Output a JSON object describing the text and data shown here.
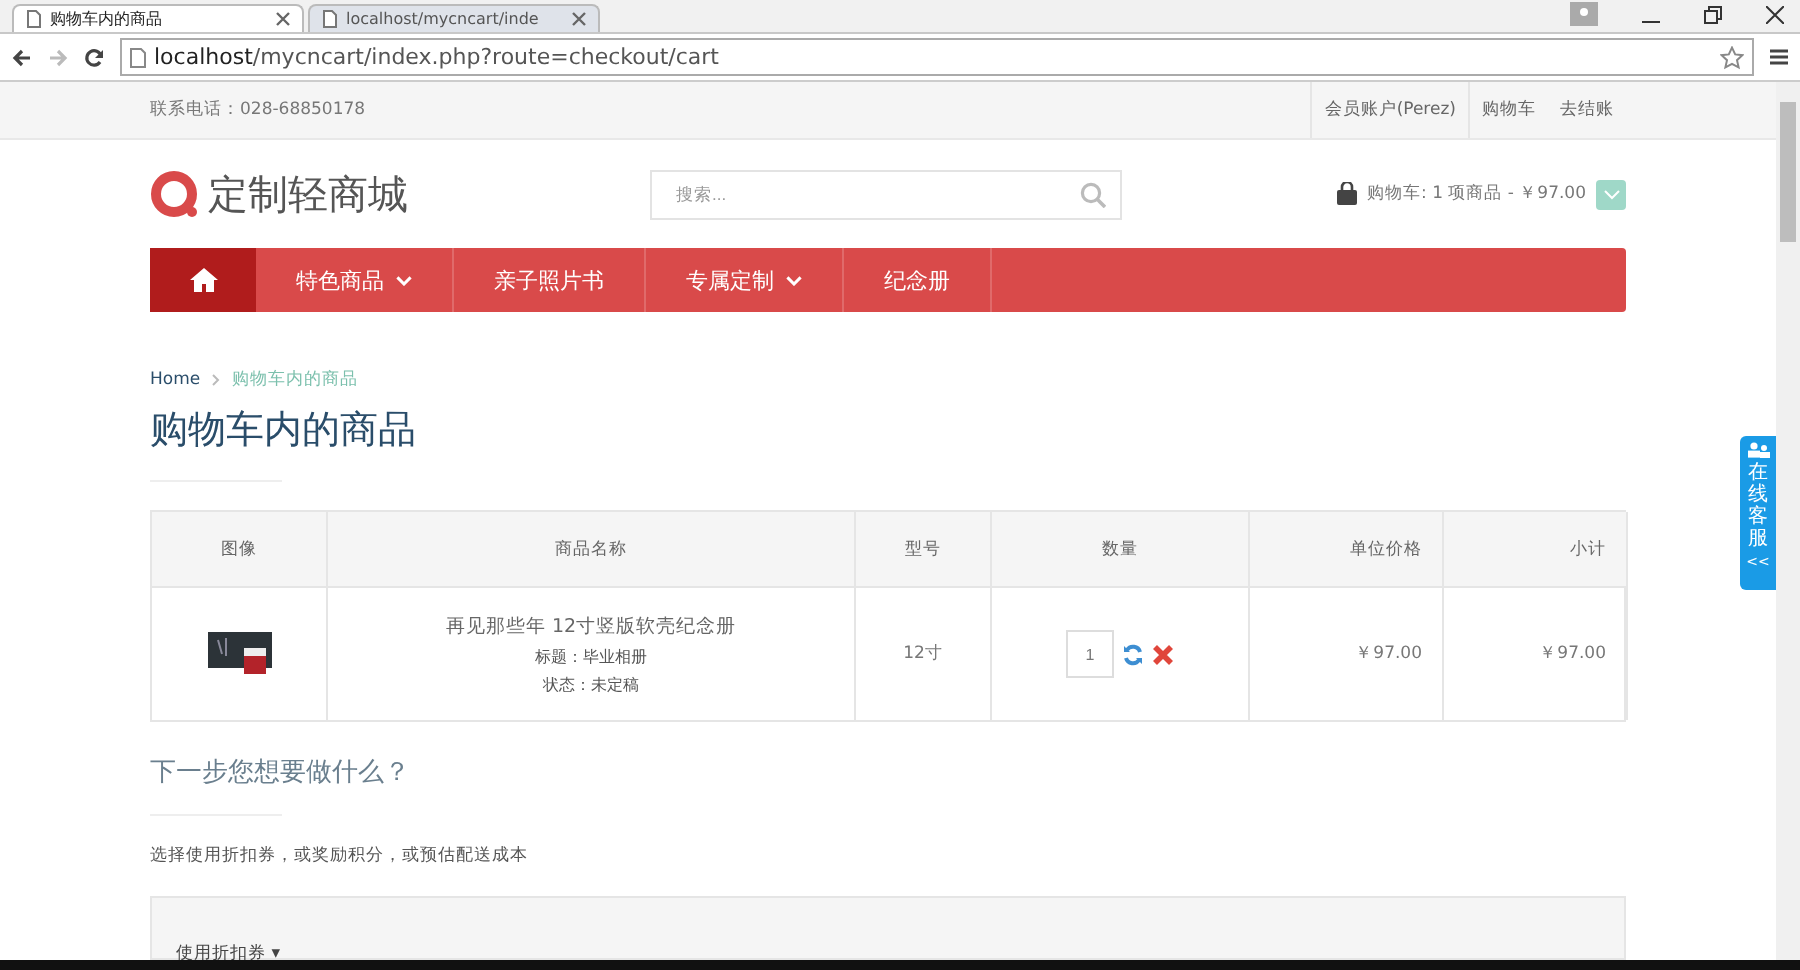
{
  "browser": {
    "tabs": [
      {
        "title": "购物车内的商品",
        "selected": true
      },
      {
        "title": "localhost/mycncart/inde",
        "selected": false
      }
    ],
    "url_host": "localhost",
    "url_path": "/mycncart/index.php?route=checkout/cart"
  },
  "top_bar": {
    "phone_label": "联系电话：",
    "phone": "028-68850178",
    "links": [
      "会员账户(Perez)",
      "购物车",
      "去结账"
    ]
  },
  "header": {
    "logo": "定制轻商城",
    "search": {
      "placeholder": "搜索..."
    },
    "cart_summary": "购物车: 1 项商品 - ￥97.00"
  },
  "nav": [
    {
      "label": "特色商品",
      "dropdown": true
    },
    {
      "label": "亲子照片书",
      "dropdown": false
    },
    {
      "label": "专属定制",
      "dropdown": true
    },
    {
      "label": "纪念册",
      "dropdown": false
    }
  ],
  "breadcrumb": [
    "Home",
    "购物车内的商品"
  ],
  "title": "购物车内的商品",
  "table": {
    "columns": [
      "图像",
      "商品名称",
      "型号",
      "数量",
      "单位价格",
      "小计"
    ],
    "rows": [
      {
        "name": "再见那些年 12寸竖版软壳纪念册",
        "options": [
          "标题：毕业相册",
          "状态：未定稿"
        ],
        "model": "12寸",
        "quantity": "1",
        "unit_price": "￥97.00",
        "total": "￥97.00"
      }
    ]
  },
  "next_title": "下一步您想要做什么？",
  "next_text": "选择使用折扣券，或奖励积分，或预估配送成本",
  "panel_heading": "使用折扣券 ▾",
  "side_widget": {
    "label": "在线客服",
    "arrow": "<<"
  }
}
